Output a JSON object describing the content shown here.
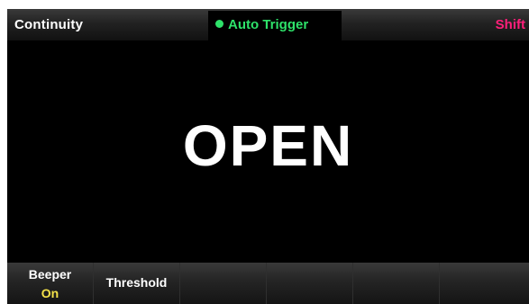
{
  "header": {
    "mode": "Continuity",
    "trigger": "Auto Trigger",
    "shift": "Shift"
  },
  "display": {
    "reading": "OPEN"
  },
  "softkeys": [
    {
      "label": "Beeper",
      "value": "On"
    },
    {
      "label": "Threshold",
      "value": ""
    },
    {
      "label": "",
      "value": ""
    },
    {
      "label": "",
      "value": ""
    },
    {
      "label": "",
      "value": ""
    },
    {
      "label": "",
      "value": ""
    }
  ],
  "colors": {
    "trigger": "#2ee26a",
    "shift": "#ff1f7a",
    "softkey_value": "#f4e24a",
    "text": "#ffffff",
    "background": "#000000"
  }
}
